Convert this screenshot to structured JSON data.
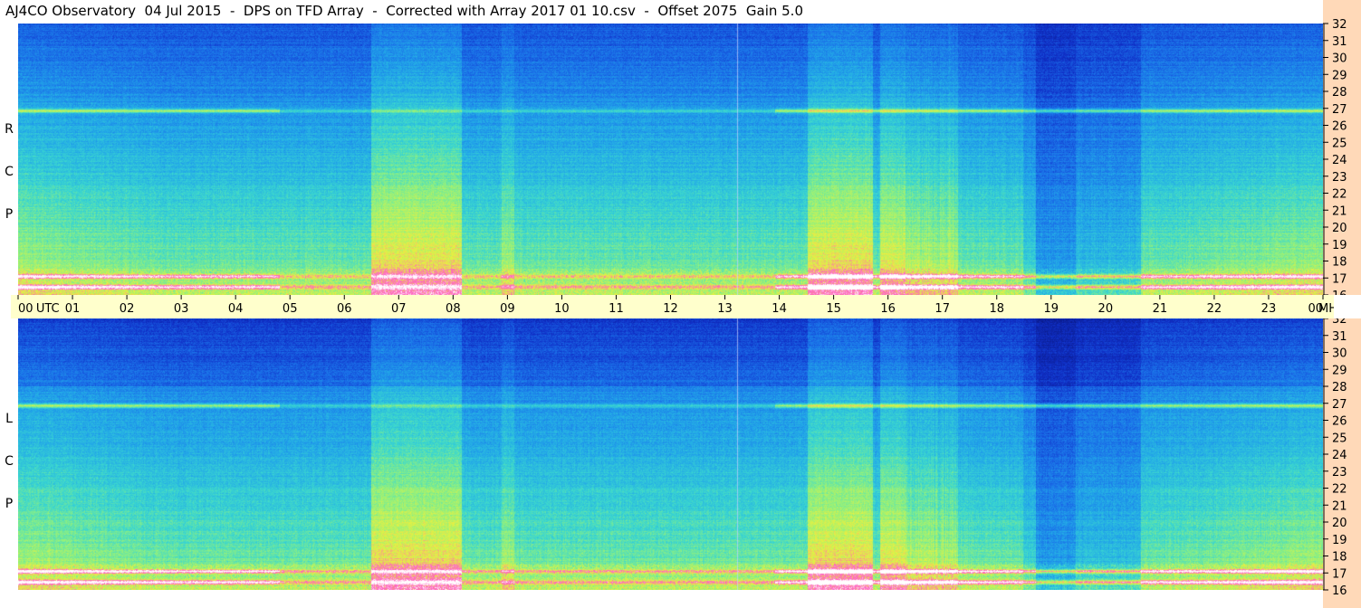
{
  "chart_data": {
    "type": "heatmap",
    "title": "AJ4CO Observatory  04 Jul 2015  -  DPS on TFD Array  -  Corrected with Array 2017 01 10.csv  -  Offset 2075  Gain 5.0",
    "x_unit": "UTC",
    "y_unit": "MHz",
    "x_ticks": [
      "00",
      "01",
      "02",
      "03",
      "04",
      "05",
      "06",
      "07",
      "08",
      "09",
      "10",
      "11",
      "12",
      "13",
      "14",
      "15",
      "16",
      "17",
      "18",
      "19",
      "20",
      "21",
      "22",
      "23",
      "00"
    ],
    "ylim": [
      16,
      32
    ],
    "y_ticks": [
      32,
      31,
      30,
      29,
      28,
      27,
      26,
      25,
      24,
      23,
      22,
      21,
      20,
      19,
      18,
      17,
      16
    ],
    "panels": [
      {
        "name": "RCP",
        "letters": [
          "R",
          "C",
          "P"
        ]
      },
      {
        "name": "LCP",
        "letters": [
          "L",
          "C",
          "P"
        ]
      }
    ],
    "colorscale": [
      "#0a1a8a",
      "#1030c8",
      "#1a6ee8",
      "#22a8e8",
      "#3ad6d0",
      "#8ef080",
      "#e8f040",
      "#ff60c0",
      "#ffffff"
    ]
  }
}
